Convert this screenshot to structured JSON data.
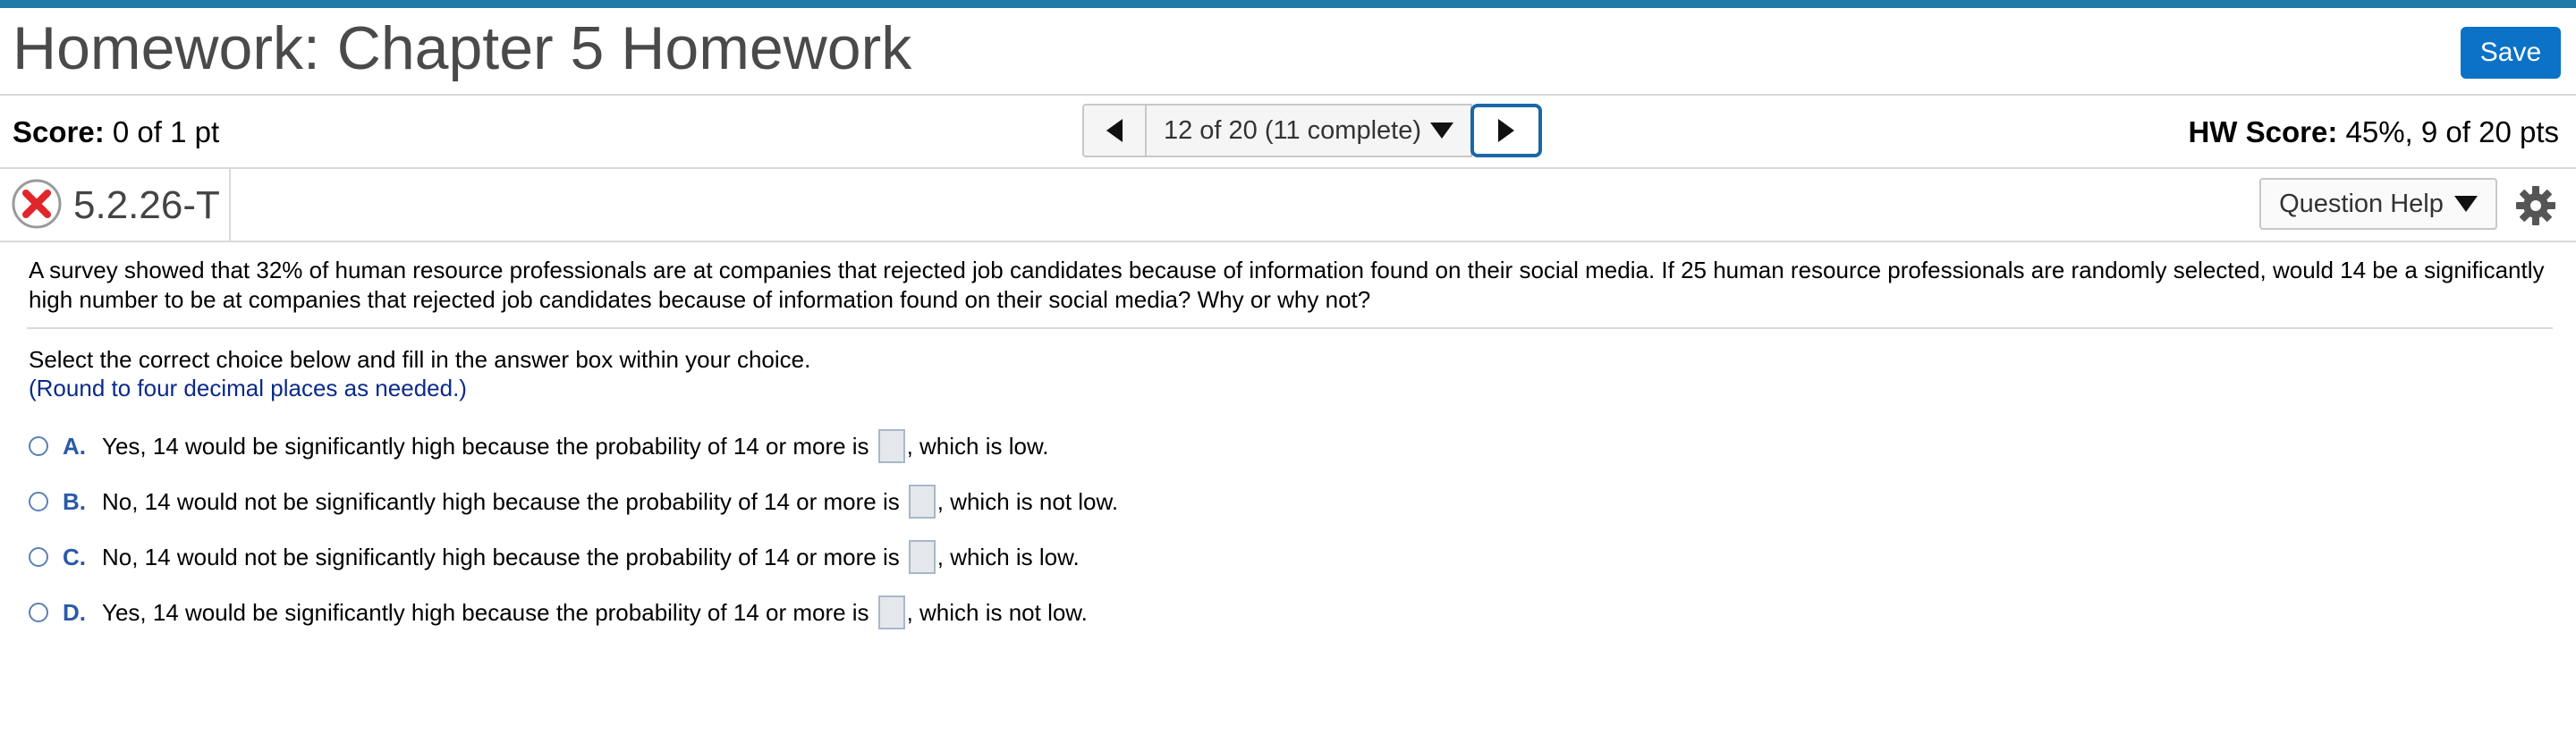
{
  "header": {
    "title": "Homework: Chapter 5 Homework",
    "save_label": "Save"
  },
  "scorebar": {
    "score_label": "Score:",
    "score_value": "0 of 1 pt",
    "nav_position": "12 of 20 (11 complete)",
    "hw_score_label": "HW Score:",
    "hw_score_value": "45%, 9 of 20 pts"
  },
  "question_bar": {
    "status_icon": "x-circle-icon",
    "question_id": "5.2.26-T",
    "help_label": "Question Help"
  },
  "question": {
    "prompt": "A survey showed that 32% of human resource professionals are at companies that rejected job candidates because of information found on their social media. If 25 human resource professionals are randomly selected, would 14 be a significantly high number to be at companies that rejected job candidates because of information found on their social media? Why or why not?",
    "instruction": "Select the correct choice below and fill in the answer box within your choice.",
    "hint": "(Round to four decimal places as needed.)",
    "choices": [
      {
        "letter": "A.",
        "before": "Yes, 14 would be significantly high because the probability of 14 or more is",
        "after": ", which is low."
      },
      {
        "letter": "B.",
        "before": "No, 14 would not be significantly high because the probability of 14 or more is",
        "after": ", which is not low."
      },
      {
        "letter": "C.",
        "before": "No, 14 would not be significantly high because the probability of 14 or more is",
        "after": ", which is low."
      },
      {
        "letter": "D.",
        "before": "Yes, 14 would be significantly high because the probability of 14 or more is",
        "after": ", which is not low."
      }
    ]
  },
  "colors": {
    "accent_bar": "#1f7aa8",
    "save_button": "#0b72c7",
    "incorrect": "#e0262b",
    "choice_letter": "#2a5aa8",
    "hint_text": "#0a2a8a"
  }
}
